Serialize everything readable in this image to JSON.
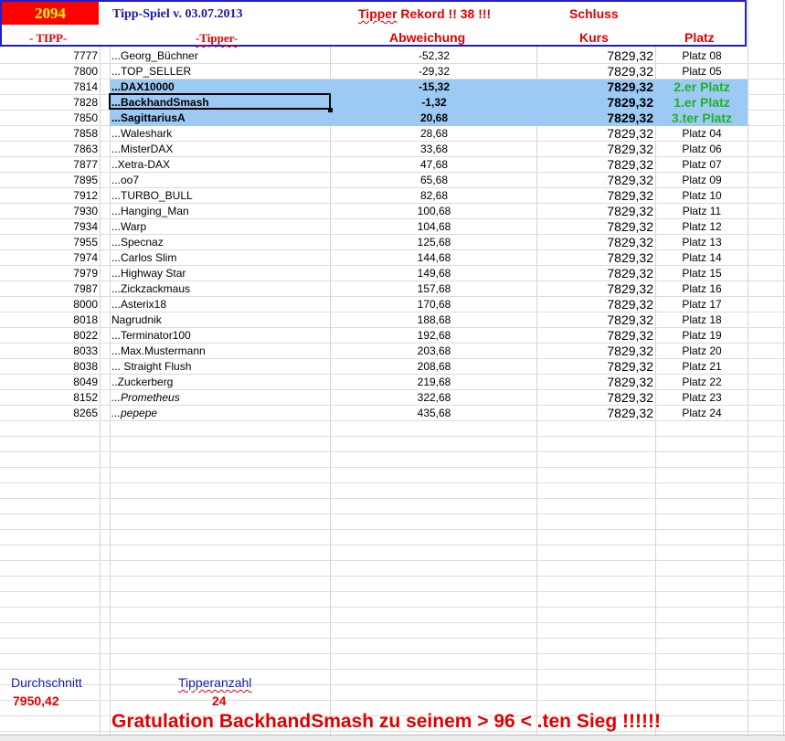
{
  "header": {
    "tipp_number": "2094",
    "title": "Tipp-Spiel v. 03.07.2013",
    "rekord_word": "Tipper",
    "rekord_rest": " Rekord !!  38  !!!",
    "schluss": "Schluss",
    "col_tipp": "- TIPP-",
    "col_tipper": "-Tipper-",
    "col_abweichung": "Abweichung",
    "col_kurs": "Kurs",
    "col_platz": "Platz"
  },
  "colors": {
    "header_border": "#1e1ecc",
    "header_text": "#e00000",
    "tipp_bg": "#ff0000",
    "tipp_fg": "#ffff00",
    "highlight_bg": "#9ccaf5",
    "podium_text": "#22b222",
    "footer_label": "#1a1aa8"
  },
  "rows": [
    {
      "tipp": "7777",
      "name": "...Georg_Büchner",
      "abw": "-52,32",
      "kurs": "7829,32",
      "platz": "Platz 08"
    },
    {
      "tipp": "7800",
      "name": "...TOP_SELLER",
      "abw": "-29,32",
      "kurs": "7829,32",
      "platz": "Platz 05"
    },
    {
      "tipp": "7814",
      "name": "...DAX10000",
      "abw": "-15,32",
      "kurs": "7829,32",
      "platz": "2.er Platz"
    },
    {
      "tipp": "7828",
      "name": "...BackhandSmash",
      "abw": "-1,32",
      "kurs": "7829,32",
      "platz": "1.er Platz"
    },
    {
      "tipp": "7850",
      "name": "...SagittariusA",
      "abw": "20,68",
      "kurs": "7829,32",
      "platz": "3.ter Platz"
    },
    {
      "tipp": "7858",
      "name": "...Waleshark",
      "abw": "28,68",
      "kurs": "7829,32",
      "platz": "Platz 04"
    },
    {
      "tipp": "7863",
      "name": "...MisterDAX",
      "abw": "33,68",
      "kurs": "7829,32",
      "platz": "Platz 06"
    },
    {
      "tipp": "7877",
      "name": "..Xetra-DAX",
      "abw": "47,68",
      "kurs": "7829,32",
      "platz": "Platz 07"
    },
    {
      "tipp": "7895",
      "name": "...oo7",
      "abw": "65,68",
      "kurs": "7829,32",
      "platz": "Platz 09"
    },
    {
      "tipp": "7912",
      "name": "...TURBO_BULL",
      "abw": "82,68",
      "kurs": "7829,32",
      "platz": "Platz 10"
    },
    {
      "tipp": "7930",
      "name": "...Hanging_Man",
      "abw": "100,68",
      "kurs": "7829,32",
      "platz": "Platz 11"
    },
    {
      "tipp": "7934",
      "name": "...Warp",
      "abw": "104,68",
      "kurs": "7829,32",
      "platz": "Platz 12"
    },
    {
      "tipp": "7955",
      "name": "...Specnaz",
      "abw": "125,68",
      "kurs": "7829,32",
      "platz": "Platz 13"
    },
    {
      "tipp": "7974",
      "name": "...Carlos Slim",
      "abw": "144,68",
      "kurs": "7829,32",
      "platz": "Platz 14"
    },
    {
      "tipp": "7979",
      "name": "...Highway Star",
      "abw": "149,68",
      "kurs": "7829,32",
      "platz": "Platz 15"
    },
    {
      "tipp": "7987",
      "name": "...Zickzackmaus",
      "abw": "157,68",
      "kurs": "7829,32",
      "platz": "Platz 16"
    },
    {
      "tipp": "8000",
      "name": "...Asterix18",
      "abw": "170,68",
      "kurs": "7829,32",
      "platz": "Platz 17"
    },
    {
      "tipp": "8018",
      "name": " Nagrudnik",
      "abw": "188,68",
      "kurs": "7829,32",
      "platz": "Platz 18"
    },
    {
      "tipp": "8022",
      "name": "...Terminator100",
      "abw": "192,68",
      "kurs": "7829,32",
      "platz": "Platz 19"
    },
    {
      "tipp": "8033",
      "name": "...Max.Mustermann",
      "abw": "203,68",
      "kurs": "7829,32",
      "platz": "Platz 20"
    },
    {
      "tipp": "8038",
      "name": "... Straight Flush",
      "abw": "208,68",
      "kurs": "7829,32",
      "platz": "Platz 21"
    },
    {
      "tipp": "8049",
      "name": "..Zuckerberg",
      "abw": "219,68",
      "kurs": "7829,32",
      "platz": "Platz 22"
    },
    {
      "tipp": "8152",
      "name": "...Prometheus",
      "abw": "322,68",
      "kurs": "7829,32",
      "platz": "Platz 23"
    },
    {
      "tipp": "8265",
      "name": "...pepepe",
      "abw": "435,68",
      "kurs": "7829,32",
      "platz": "Platz 24"
    }
  ],
  "footer": {
    "durchschnitt_label": "Durchschnitt",
    "durchschnitt_value": "7950,42",
    "tipperanzahl_label": "Tipperanzahl",
    "tipperanzahl_value": "24",
    "gratulation": "Gratulation BackhandSmash zu seinem > 96 < .ten Sieg !!!!!!"
  }
}
